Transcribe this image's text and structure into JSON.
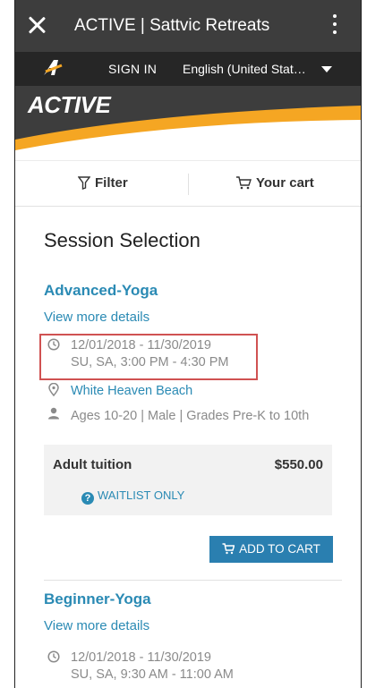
{
  "titlebar": {
    "title": "ACTIVE | Sattvic Retreats"
  },
  "signbar": {
    "signin": "SIGN IN",
    "language": "English (United Stat…"
  },
  "banner": {
    "brand": "ACTIVE"
  },
  "actions": {
    "filter": "Filter",
    "cart": "Your cart"
  },
  "page": {
    "heading": "Session Selection"
  },
  "sessions": [
    {
      "name": "Advanced-Yoga",
      "details_link": "View more details",
      "dates": "12/01/2018 - 11/30/2019",
      "schedule": "SU, SA, 3:00 PM - 4:30 PM",
      "location": "White Heaven Beach",
      "eligibility": "Ages 10-20 | Male | Grades Pre-K to 10th",
      "tuition_label": "Adult tuition",
      "tuition_price": "$550.00",
      "waitlist": "WAITLIST ONLY",
      "add_to_cart": "ADD TO CART"
    },
    {
      "name": "Beginner-Yoga",
      "details_link": "View more details",
      "dates": "12/01/2018 - 11/30/2019",
      "schedule": "SU, SA, 9:30 AM - 11:00 AM"
    }
  ],
  "colors": {
    "link": "#2a8ab4",
    "header_dark": "#3d3d3d",
    "brand_orange": "#f5a623",
    "highlight": "#d05252"
  },
  "icons": [
    "close-icon",
    "more-vert-icon",
    "active-a-logo",
    "chevron-down-icon",
    "filter-icon",
    "cart-icon",
    "clock-icon",
    "location-pin-icon",
    "person-icon",
    "help-circle-icon"
  ]
}
